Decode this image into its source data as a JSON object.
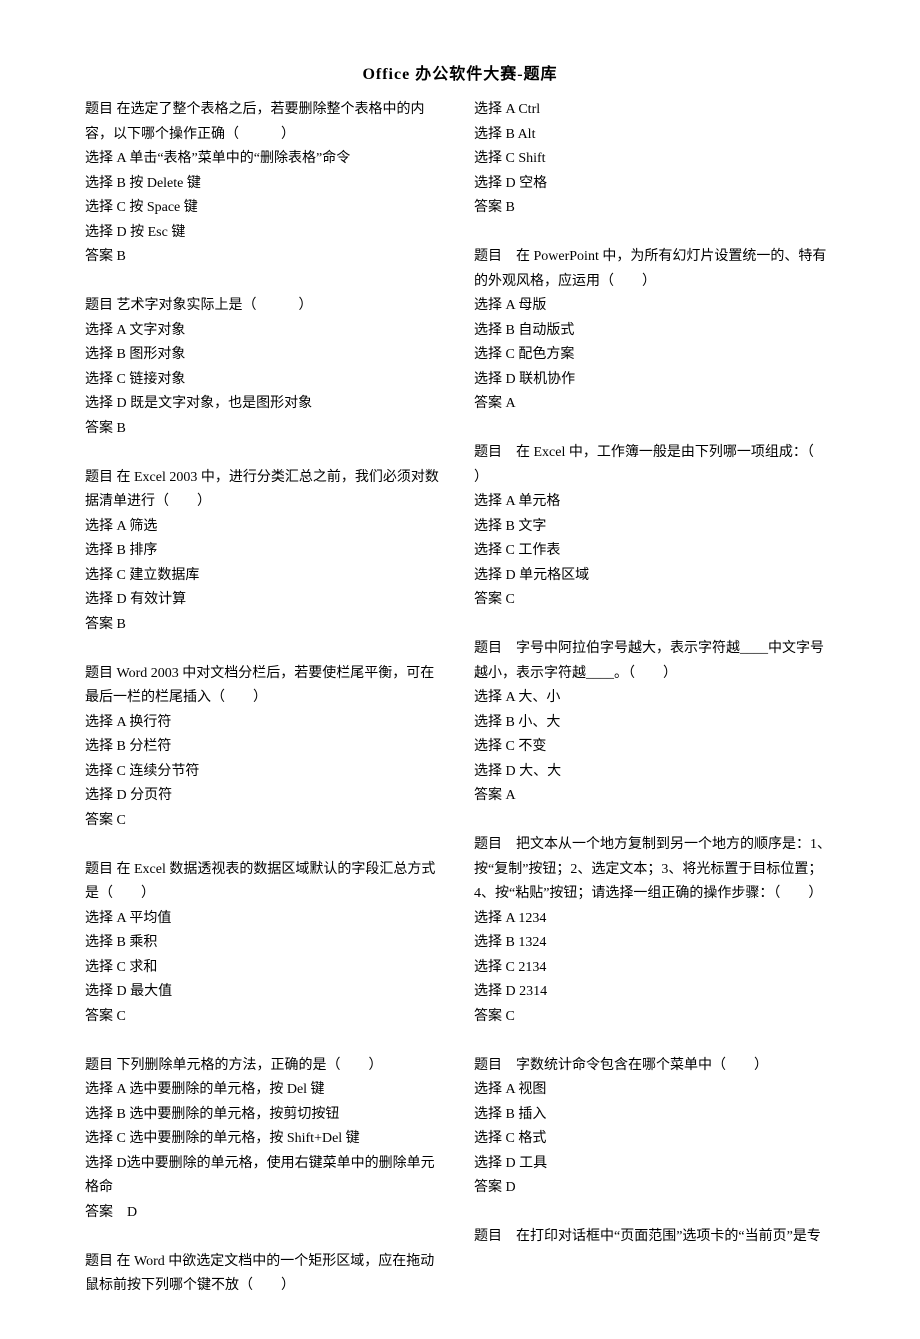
{
  "title": "Office 办公软件大赛-题库",
  "lines": [
    "题目 在选定了整个表格之后，若要删除整个表格中的内容，以下哪个操作正确（　　　）",
    "选择 A 单击“表格”菜单中的“删除表格”命令",
    "选择 B 按 Delete 键",
    "选择 C 按 Space 键",
    "选择 D 按 Esc 键",
    "答案 B",
    "",
    "题目 艺术字对象实际上是（　　　）",
    "选择 A 文字对象",
    "选择 B 图形对象",
    "选择 C 链接对象",
    "选择 D 既是文字对象，也是图形对象",
    "答案 B",
    "",
    "题目 在 Excel 2003 中，进行分类汇总之前，我们必须对数据清单进行（　　）",
    "选择 A 筛选",
    "选择 B 排序",
    "选择 C 建立数据库",
    "选择 D 有效计算",
    "答案 B",
    "",
    "题目 Word 2003 中对文档分栏后，若要使栏尾平衡，可在最后一栏的栏尾插入（　　）",
    "选择 A 换行符",
    "选择 B 分栏符",
    "选择 C 连续分节符",
    "选择 D 分页符",
    "答案 C",
    "",
    "题目 在 Excel 数据透视表的数据区域默认的字段汇总方式是（　　）",
    "选择 A 平均值",
    "选择 B 乘积",
    "选择 C 求和",
    "选择 D 最大值",
    "答案 C",
    "",
    "题目 下列删除单元格的方法，正确的是（　　）",
    "选择 A 选中要删除的单元格，按 Del 键",
    "选择 B 选中要删除的单元格，按剪切按钮",
    "选择 C 选中要删除的单元格，按 Shift+Del 键",
    "选择 D选中要删除的单元格，使用右键菜单中的删除单元格命",
    "答案　D",
    "",
    "题目 在 Word 中欲选定文档中的一个矩形区域，应在拖动鼠标前按下列哪个键不放（　　）",
    "选择 A Ctrl",
    "选择 B Alt",
    "选择 C Shift",
    "选择 D 空格",
    "答案 B",
    "",
    "题目　在 PowerPoint 中，为所有幻灯片设置统一的、特有的外观风格，应运用（　　）",
    "选择 A 母版",
    "选择 B 自动版式",
    "选择 C 配色方案",
    "选择 D 联机协作",
    "答案 A",
    "",
    "题目　在 Excel 中，工作簿一般是由下列哪一项组成：（　　）",
    "选择 A 单元格",
    "选择 B 文字",
    "选择 C 工作表",
    "选择 D 单元格区域",
    "答案 C",
    "",
    "题目　字号中阿拉伯字号越大，表示字符越____中文字号越小，表示字符越____。（　　）",
    "选择 A 大、小",
    "选择 B 小、大",
    "选择 C 不变",
    "选择 D 大、大",
    "答案 A",
    "",
    "题目　把文本从一个地方复制到另一个地方的顺序是：1、按“复制”按钮；2、选定文本；3、将光标置于目标位置；4、按“粘贴”按钮；请选择一组正确的操作步骤：（　　）",
    "选择 A 1234",
    "选择 B 1324",
    "选择 C 2134",
    "选择 D 2314",
    "答案 C",
    "",
    "题目　字数统计命令包含在哪个菜单中（　　）",
    "选择 A 视图",
    "选择 B 插入",
    "选择 C 格式",
    "选择 D 工具",
    "答案 D",
    "",
    "题目　在打印对话框中“页面范围”选项卡的“当前页”是专"
  ]
}
